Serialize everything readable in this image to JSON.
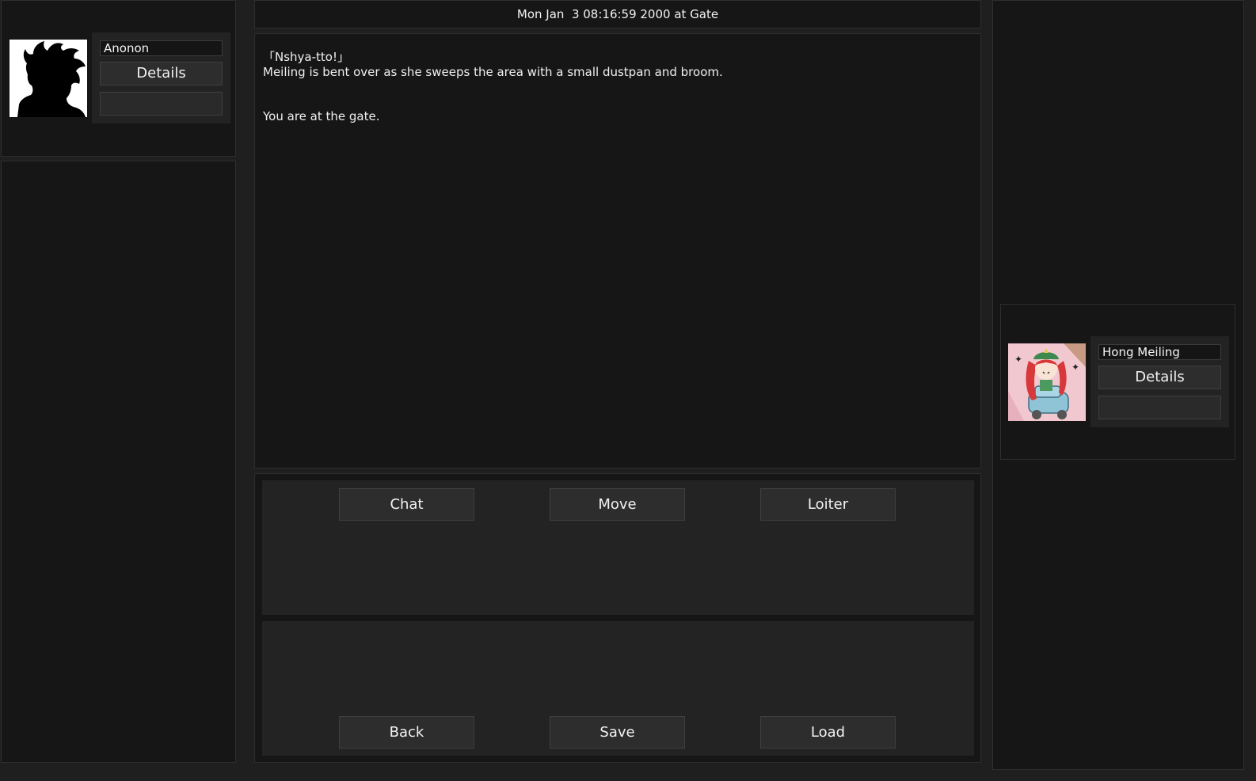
{
  "left_character": {
    "name": "Anonon",
    "portrait_icon": "silhouette-portrait-icon",
    "details_label": "Details",
    "secondary_label": ""
  },
  "header": {
    "status": "Mon Jan  3 08:16:59 2000 at Gate"
  },
  "log": {
    "lines": [
      "「Nshya-tto!」",
      "Meiling is bent over as she sweeps the area with a small dustpan and broom.",
      "You are at the gate."
    ]
  },
  "actions": {
    "chat": "Chat",
    "move": "Move",
    "loiter": "Loiter"
  },
  "system": {
    "back": "Back",
    "save": "Save",
    "load": "Load"
  },
  "right_character": {
    "name": "Hong Meiling",
    "portrait_icon": "hong-meiling-portrait",
    "details_label": "Details",
    "secondary_label": ""
  },
  "colors": {
    "background": "#1f1f1f",
    "panel": "#161616",
    "button": "#2d2d2d",
    "meiling_hair": "#d8383a",
    "meiling_hat": "#3c8a4f"
  }
}
